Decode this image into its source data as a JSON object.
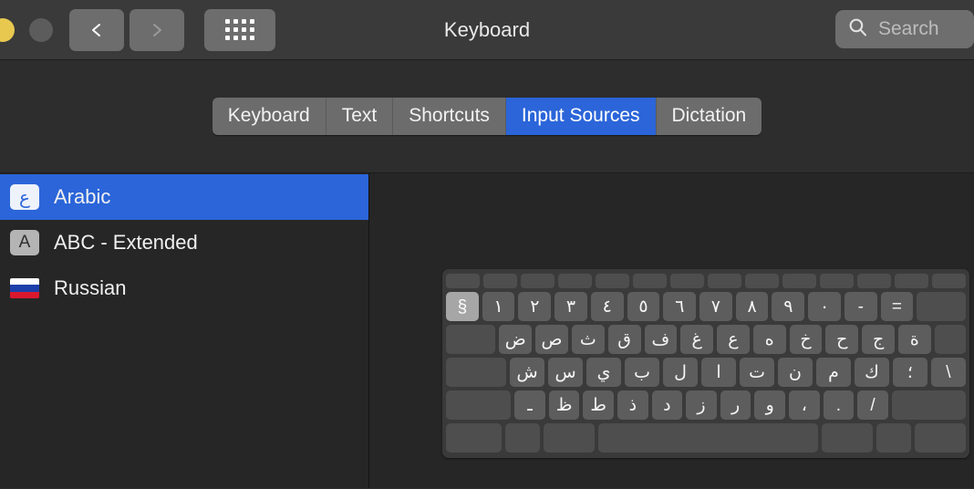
{
  "window": {
    "title": "Keyboard",
    "traffic_lights": [
      "close-yellow",
      "minimize-gray"
    ],
    "nav": {
      "back_label": "‹",
      "forward_label": "›"
    },
    "grid_button": "all-preferences-grid"
  },
  "search": {
    "placeholder": "Search",
    "value": ""
  },
  "tabs": [
    {
      "label": "Keyboard",
      "selected": false
    },
    {
      "label": "Text",
      "selected": false
    },
    {
      "label": "Shortcuts",
      "selected": false
    },
    {
      "label": "Input Sources",
      "selected": true
    },
    {
      "label": "Dictation",
      "selected": false
    }
  ],
  "sidebar": {
    "items": [
      {
        "label": "Arabic",
        "icon": "ع",
        "icon_kind": "arabic",
        "selected": true
      },
      {
        "label": "ABC - Extended",
        "icon": "A",
        "icon_kind": "abc",
        "selected": false
      },
      {
        "label": "Russian",
        "icon": "flag",
        "icon_kind": "flag",
        "selected": false
      }
    ]
  },
  "keyboard_preview": {
    "layout_name": "Arabic",
    "rows": {
      "function": [
        "",
        "",
        "",
        "",
        "",
        "",
        "",
        "",
        "",
        "",
        "",
        "",
        "",
        ""
      ],
      "numbers": [
        "§",
        "١",
        "٢",
        "٣",
        "٤",
        "٥",
        "٦",
        "٧",
        "٨",
        "٩",
        "٠",
        "-",
        "=",
        ""
      ],
      "upper": [
        "",
        "ض",
        "ص",
        "ث",
        "ق",
        "ف",
        "غ",
        "ع",
        "ه",
        "خ",
        "ح",
        "ج",
        "ة",
        ""
      ],
      "home": [
        "",
        "ش",
        "س",
        "ي",
        "ب",
        "ل",
        "ا",
        "ت",
        "ن",
        "م",
        "ك",
        "؛",
        "\\"
      ],
      "lower": [
        "",
        "ـ",
        "ظ",
        "ط",
        "ذ",
        "د",
        "ز",
        "ر",
        "و",
        "،",
        ".",
        "/",
        ""
      ],
      "bottom": [
        "",
        "",
        "",
        "",
        "",
        "",
        ""
      ]
    },
    "highlighted_key": "§"
  },
  "colors": {
    "accent_blue": "#2b65d9",
    "titlebar": "#3a3a3a",
    "background": "#2d2d2d",
    "panel": "#262626",
    "key": "#5d5d5d",
    "key_dark": "#4e4e4e",
    "key_highlight": "#a6a6a6"
  }
}
